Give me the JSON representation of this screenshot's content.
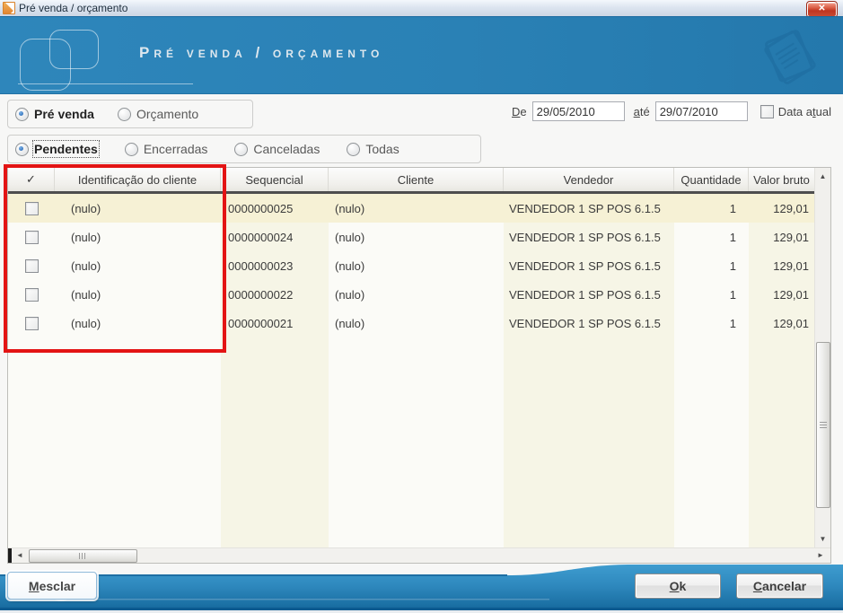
{
  "window": {
    "title": "Pré venda / orçamento"
  },
  "header": {
    "title": "Pré venda / orçamento"
  },
  "icons": {
    "close": "✕",
    "check_header": "✓",
    "arrow_up": "▲",
    "arrow_down": "▼",
    "arrow_left": "◄",
    "arrow_right": "►"
  },
  "filters": {
    "type": {
      "options": [
        {
          "label": "Pré venda",
          "selected": true
        },
        {
          "label": "Orçamento",
          "selected": false
        }
      ]
    },
    "status": {
      "options": [
        {
          "label": "Pendentes",
          "selected": true
        },
        {
          "label": "Encerradas",
          "selected": false
        },
        {
          "label": "Canceladas",
          "selected": false
        },
        {
          "label": "Todas",
          "selected": false
        }
      ]
    },
    "date": {
      "de_label": {
        "accel": "D",
        "rest": "e"
      },
      "de_value": "29/05/2010",
      "ate_label": {
        "accel": "a",
        "rest": "té"
      },
      "ate_value": "29/07/2010",
      "data_atual_label": {
        "pre": "Data a",
        "accel": "t",
        "rest": "ual"
      },
      "data_atual_checked": false
    }
  },
  "table": {
    "header": {
      "ident": "Identificação do cliente",
      "seq": "Sequencial",
      "cliente": "Cliente",
      "vendedor": "Vendedor",
      "qtd": "Quantidade",
      "valor": "Valor bruto"
    },
    "rows": [
      {
        "ident": "(nulo)",
        "seq": "0000000025",
        "cliente": "(nulo)",
        "vendedor": "VENDEDOR 1 SP POS 6.1.5",
        "qtd": "1",
        "valor": "129,01",
        "checked": false,
        "selected": true
      },
      {
        "ident": "(nulo)",
        "seq": "0000000024",
        "cliente": "(nulo)",
        "vendedor": "VENDEDOR 1 SP POS 6.1.5",
        "qtd": "1",
        "valor": "129,01",
        "checked": false,
        "selected": false
      },
      {
        "ident": "(nulo)",
        "seq": "0000000023",
        "cliente": "(nulo)",
        "vendedor": "VENDEDOR 1 SP POS 6.1.5",
        "qtd": "1",
        "valor": "129,01",
        "checked": false,
        "selected": false
      },
      {
        "ident": "(nulo)",
        "seq": "0000000022",
        "cliente": "(nulo)",
        "vendedor": "VENDEDOR 1 SP POS 6.1.5",
        "qtd": "1",
        "valor": "129,01",
        "checked": false,
        "selected": false
      },
      {
        "ident": "(nulo)",
        "seq": "0000000021",
        "cliente": "(nulo)",
        "vendedor": "VENDEDOR 1 SP POS 6.1.5",
        "qtd": "1",
        "valor": "129,01",
        "checked": false,
        "selected": false
      }
    ]
  },
  "footer": {
    "mesclar": {
      "accel": "M",
      "rest": "esclar"
    },
    "ok": {
      "accel": "O",
      "rest": "k"
    },
    "cancelar": {
      "accel": "C",
      "rest": "ancelar"
    }
  },
  "colors": {
    "header_blue": "#2a81b5",
    "footer_blue_light": "#3e9ccf",
    "footer_blue_dark": "#1a6fa3",
    "selected_row": "#f6f1d5",
    "band_cream": "#f6f5e6",
    "annotation_red": "#e31414",
    "close_red": "#bf3520"
  }
}
